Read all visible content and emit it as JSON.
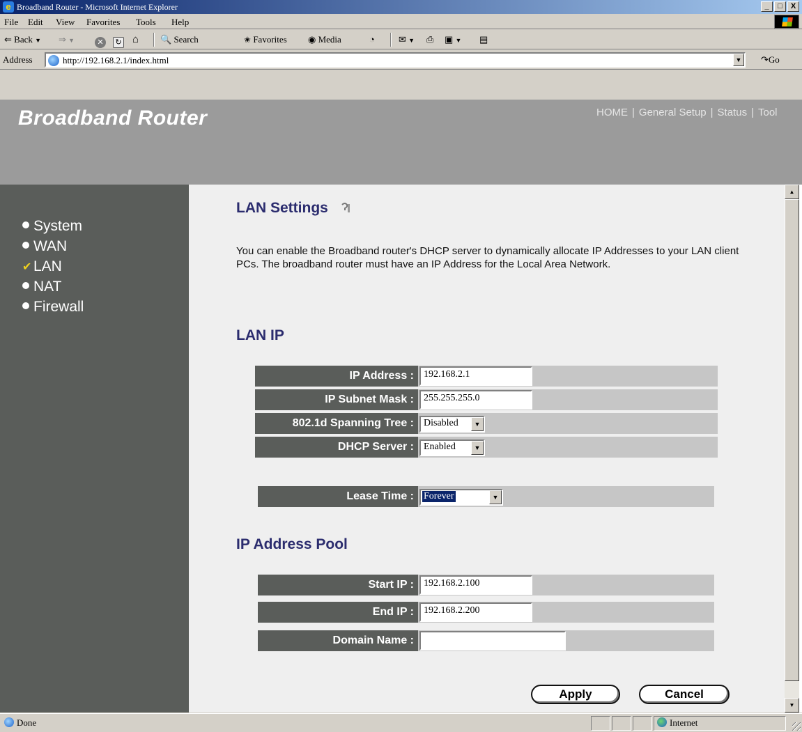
{
  "window": {
    "title": "Broadband Router - Microsoft Internet Explorer",
    "buttons": [
      "_",
      "□",
      "X"
    ]
  },
  "menu": [
    "File",
    "Edit",
    "View",
    "Favorites",
    "Tools",
    "Help"
  ],
  "toolbar": {
    "back": "Back",
    "search": "Search",
    "favorites": "Favorites",
    "media": "Media"
  },
  "address": {
    "label": "Address",
    "url": "http://192.168.2.1/index.html",
    "go": "Go"
  },
  "header": {
    "brand": "Broadband Router",
    "nav": [
      "HOME",
      "General Setup",
      "Status",
      "Tool"
    ]
  },
  "sidebar": {
    "items": [
      {
        "label": "System",
        "selected": false
      },
      {
        "label": "WAN",
        "selected": false
      },
      {
        "label": "LAN",
        "selected": true
      },
      {
        "label": "NAT",
        "selected": false
      },
      {
        "label": "Firewall",
        "selected": false
      }
    ]
  },
  "content": {
    "title": "LAN Settings",
    "description": "You can enable the Broadband router's DHCP server to dynamically allocate IP Addresses to your LAN client PCs. The broadband router must have an IP Address for the Local Area Network.",
    "lan_ip_title": "LAN IP",
    "pool_title": "IP Address Pool",
    "fields": {
      "ip_address": {
        "label": "IP Address :",
        "value": "192.168.2.1"
      },
      "subnet_mask": {
        "label": "IP Subnet Mask :",
        "value": "255.255.255.0"
      },
      "spanning_tree": {
        "label": "802.1d Spanning Tree :",
        "value": "Disabled"
      },
      "dhcp_server": {
        "label": "DHCP Server :",
        "value": "Enabled"
      },
      "lease_time": {
        "label": "Lease Time :",
        "value": "Forever"
      },
      "start_ip": {
        "label": "Start IP :",
        "value": "192.168.2.100"
      },
      "end_ip": {
        "label": "End IP :",
        "value": "192.168.2.200"
      },
      "domain_name": {
        "label": "Domain Name :",
        "value": ""
      }
    },
    "apply": "Apply",
    "cancel": "Cancel"
  },
  "status": {
    "text": "Done",
    "zone": "Internet"
  }
}
